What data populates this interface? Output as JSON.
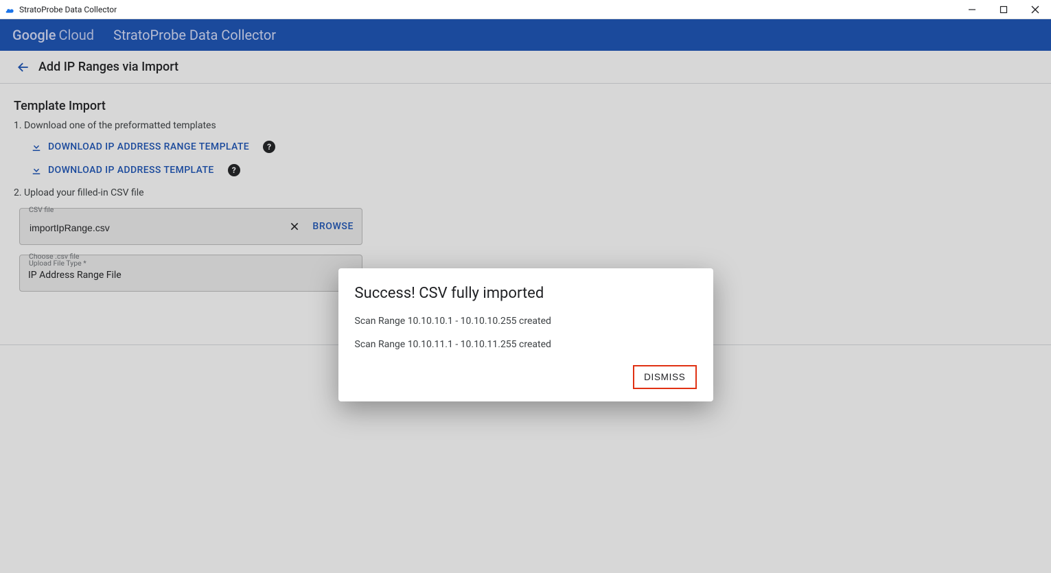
{
  "window": {
    "title": "StratoProbe Data Collector"
  },
  "banner": {
    "logo_google": "Google",
    "logo_cloud": "Cloud",
    "product": "StratoProbe Data Collector"
  },
  "page": {
    "title": "Add IP Ranges via Import"
  },
  "template_import": {
    "heading": "Template Import",
    "step1": "1. Download one of the preformatted templates",
    "download_range": "DOWNLOAD IP ADDRESS RANGE TEMPLATE",
    "download_ip": "DOWNLOAD IP ADDRESS TEMPLATE",
    "step2": "2. Upload your filled-in CSV file"
  },
  "csv_field": {
    "label": "CSV file",
    "value": "importIpRange.csv",
    "browse": "BROWSE"
  },
  "type_field": {
    "label_line1": "Choose .csv file",
    "label_line2": "Upload File Type *",
    "value": "IP Address Range File"
  },
  "dialog": {
    "title": "Success! CSV fully imported",
    "messages": [
      "Scan Range 10.10.10.1 - 10.10.10.255 created",
      "Scan Range 10.10.11.1 - 10.10.11.255 created"
    ],
    "dismiss": "DISMISS"
  }
}
